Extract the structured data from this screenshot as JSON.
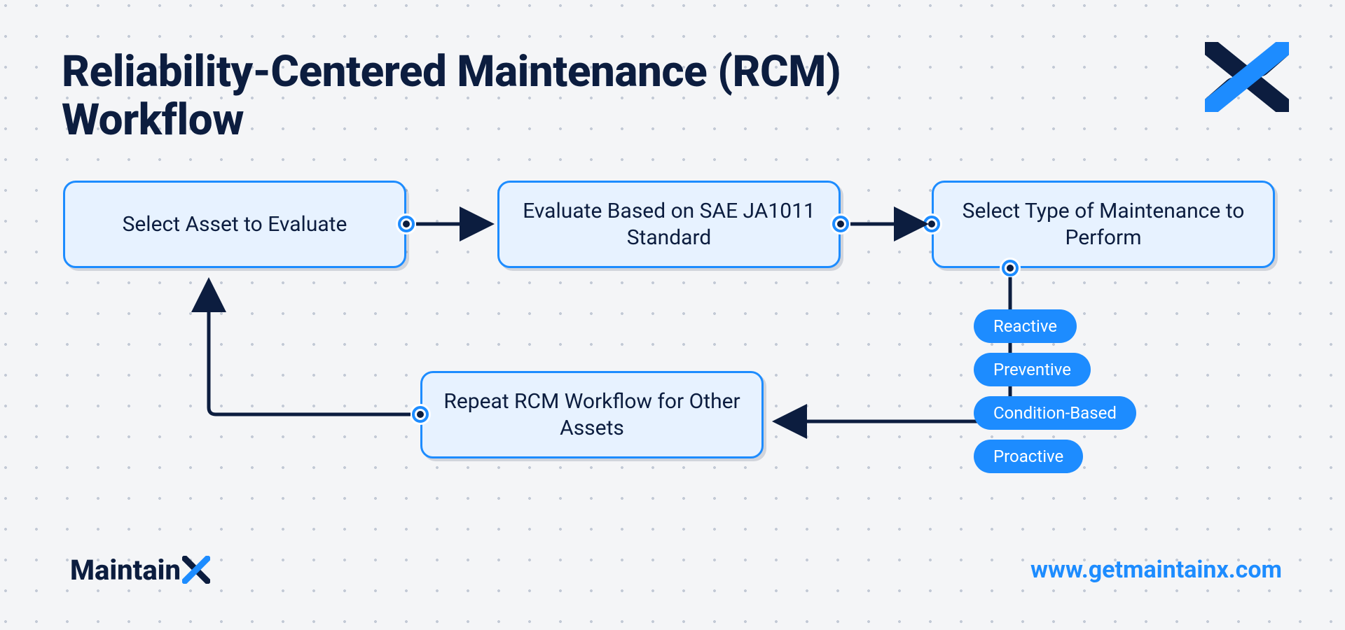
{
  "title": "Reliability-Centered Maintenance (RCM) Workflow",
  "steps": {
    "s1": "Select Asset to Evaluate",
    "s2": "Evaluate Based on SAE JA1011 Standard",
    "s3": "Select Type of Maintenance to Perform",
    "s4": "Repeat RCM Workflow for Other Assets"
  },
  "maintenance_types": [
    "Reactive",
    "Preventive",
    "Condition-Based",
    "Proactive"
  ],
  "brand": "Maintain",
  "url": "www.getmaintainx.com",
  "colors": {
    "navy": "#0c1d3f",
    "blue": "#1d8cff",
    "box_fill": "#e7f2ff",
    "bg": "#f4f5f7"
  }
}
